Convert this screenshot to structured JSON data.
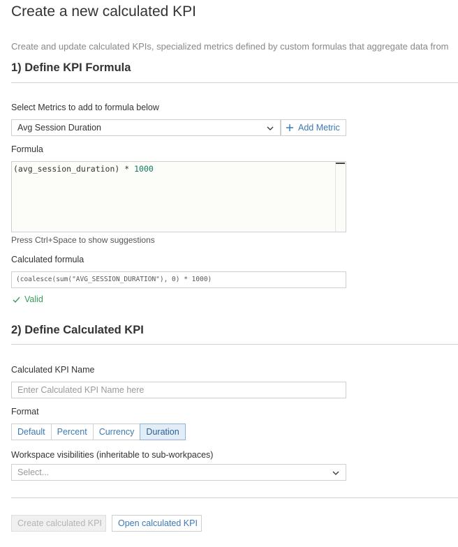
{
  "page": {
    "title": "Create a new calculated KPI",
    "description": "Create and update calculated KPIs, specialized metrics defined by custom formulas that aggregate data from"
  },
  "section1": {
    "title": "1) Define KPI Formula",
    "select_metrics_label": "Select Metrics to add to formula below",
    "selected_metric": "Avg Session Duration",
    "add_metric_label": "Add Metric",
    "formula_label": "Formula",
    "formula_text_part1": "(avg_session_duration) * ",
    "formula_text_number": "1000",
    "hint": "Press Ctrl+Space to show suggestions",
    "calculated_formula_label": "Calculated formula",
    "calculated_formula": "(coalesce(sum(\"AVG_SESSION_DURATION\"), 0) * 1000)",
    "valid_label": "Valid"
  },
  "section2": {
    "title": "2) Define Calculated KPI",
    "name_label": "Calculated KPI Name",
    "name_placeholder": "Enter Calculated KPI Name here",
    "name_value": "",
    "format_label": "Format",
    "format_options": [
      "Default",
      "Percent",
      "Currency",
      "Duration"
    ],
    "format_selected": "Duration",
    "visibility_label": "Workspace visibilities (inheritable to sub-workpaces)",
    "visibility_placeholder": "Select..."
  },
  "footer": {
    "create_label": "Create calculated KPI",
    "open_label": "Open calculated KPI"
  },
  "colors": {
    "accent": "#3c78b4",
    "valid": "#3a9a5b",
    "number": "#0c7a5e"
  }
}
